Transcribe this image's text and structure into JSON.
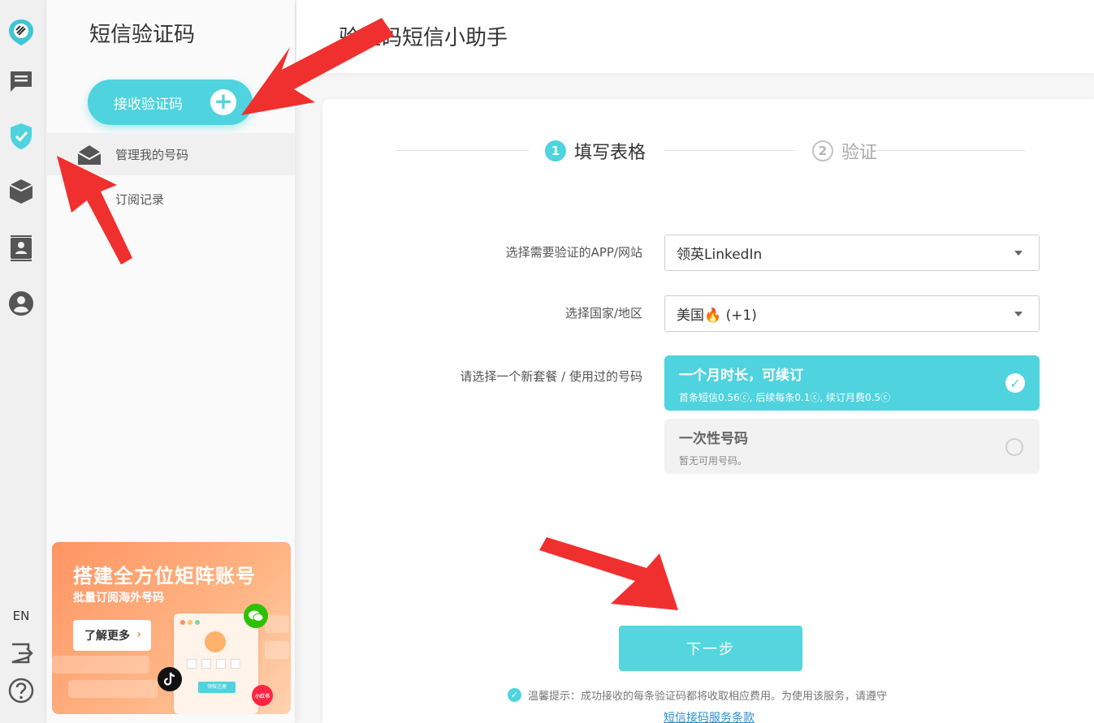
{
  "rail": {
    "icons": [
      "logo-icon",
      "chat-icon",
      "shield-check-icon",
      "box-icon",
      "contacts-icon",
      "user-icon"
    ],
    "lang": "EN",
    "bottom_icons": [
      "logout-icon",
      "help-icon"
    ]
  },
  "sidebar": {
    "title": "短信验证码",
    "receive_button": "接收验证码",
    "items": [
      {
        "label": "管理我的号码",
        "icon": "envelope-open-icon",
        "active": true
      },
      {
        "label": "订阅记录",
        "icon": "",
        "active": false
      }
    ],
    "promo": {
      "title": "搭建全方位矩阵账号",
      "subtitle": "批量订阅海外号码",
      "button": "了解更多",
      "card_button": "领取注册",
      "badge_xhs": "小红书"
    }
  },
  "header": {
    "title": "验证码短信小助手"
  },
  "steps": [
    {
      "num": "1",
      "label": "填写表格",
      "active": true
    },
    {
      "num": "2",
      "label": "验证",
      "active": false
    }
  ],
  "form": {
    "app_label": "选择需要验证的APP/网站",
    "app_value": "领英LinkedIn",
    "country_label": "选择国家/地区",
    "country_value": "美国🔥 (+1)",
    "plan_label": "请选择一个新套餐 / 使用过的号码",
    "plans": [
      {
        "title": "一个月时长，可续订",
        "desc": "首条短信0.56ⓒ, 后续每条0.1ⓒ, 续订月费0.5ⓒ",
        "selected": true
      },
      {
        "title": "一次性号码",
        "desc": "暂无可用号码。",
        "selected": false
      }
    ]
  },
  "next_button": "下一步",
  "tip": {
    "text": "温馨提示：成功接收的每条验证码都将收取相应费用。为使用该服务，请遵守",
    "link": "短信接码服务条款"
  },
  "colors": {
    "accent": "#4fd3de",
    "arrow": "#f0302e",
    "promo": "#ff9563"
  }
}
